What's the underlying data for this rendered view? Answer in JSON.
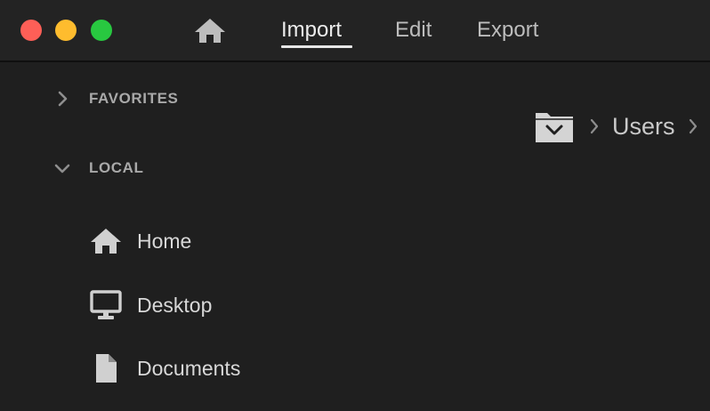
{
  "titlebar": {
    "tabs": {
      "import": "Import",
      "edit": "Edit",
      "export": "Export"
    },
    "active_tab": "Import",
    "home_icon": "home-icon"
  },
  "sidebar": {
    "favorites": {
      "label": "FAVORITES",
      "expanded": false
    },
    "local": {
      "label": "LOCAL",
      "expanded": true
    },
    "items": [
      {
        "label": "Home",
        "icon": "home-icon"
      },
      {
        "label": "Desktop",
        "icon": "desktop-icon"
      },
      {
        "label": "Documents",
        "icon": "document-icon"
      }
    ]
  },
  "breadcrumb": {
    "root_icon": "folder-dropdown-icon",
    "segments": [
      "Users"
    ]
  },
  "colors": {
    "background": "#1f1f1f",
    "titlebar": "#232323",
    "close": "#fe5f57",
    "minimize": "#febc2e",
    "maximize": "#28c840",
    "text": "#d8d8d8",
    "section_text": "#a9a9a9"
  }
}
